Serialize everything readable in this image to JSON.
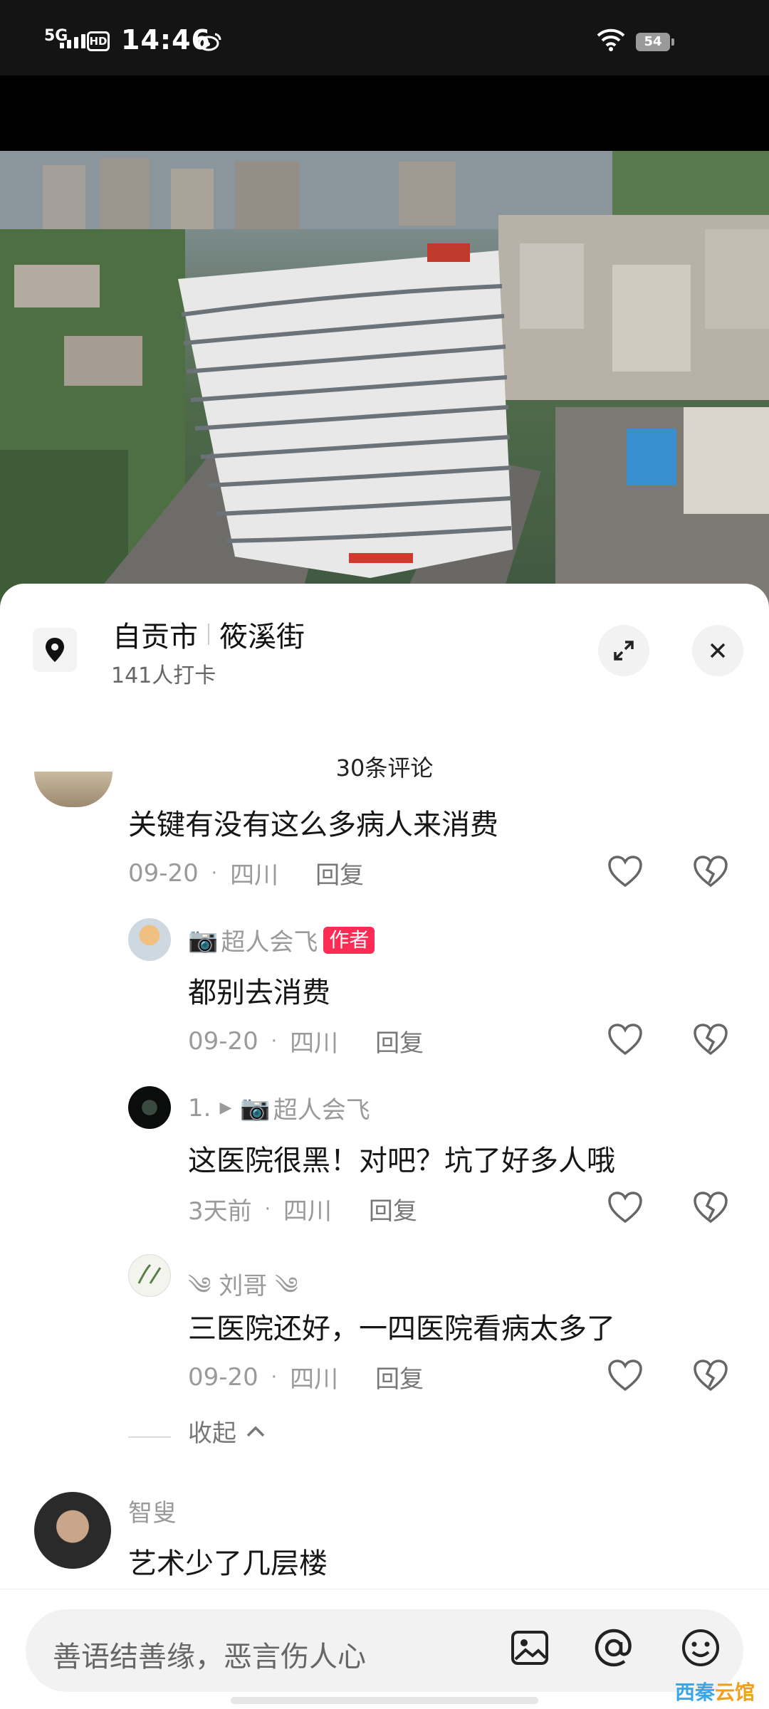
{
  "status_bar": {
    "network": "5G",
    "hd": "HD",
    "time": "14:46",
    "battery": "54"
  },
  "location": {
    "city": "自贡市",
    "street": "筱溪街",
    "checkins": "141人打卡"
  },
  "comments_header": "30条评论",
  "comments": [
    {
      "text": "关键有没有这么多病人来消费",
      "date": "09-20",
      "region": "四川",
      "reply": "回复"
    },
    {
      "user": "超人会飞",
      "badge": "作者",
      "text": "都别去消费",
      "date": "09-20",
      "region": "四川",
      "reply": "回复"
    },
    {
      "prefix": "1.",
      "user": "超人会飞",
      "text": "这医院很黑！对吧？坑了好多人哦",
      "date": "3天前",
      "region": "四川",
      "reply": "回复"
    },
    {
      "user": "༄ 刘哥 ༄",
      "text": "三医院还好，一四医院看病太多了",
      "date": "09-20",
      "region": "四川",
      "reply": "回复"
    },
    {
      "user": "智叟",
      "text": "艺术少了几层楼"
    }
  ],
  "collapse_label": "收起",
  "input": {
    "placeholder": "善语结善缘，恶言伤人心"
  },
  "watermark": {
    "part1": "西秦",
    "part2": "云馆"
  },
  "colors": {
    "accent": "#fe2c55",
    "meta": "#9a9a9a"
  }
}
